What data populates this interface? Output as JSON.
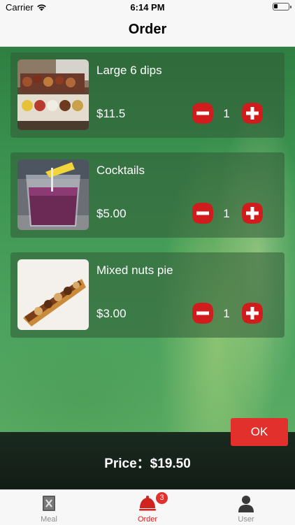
{
  "status_bar": {
    "carrier": "Carrier",
    "time": "6:14 PM"
  },
  "nav": {
    "title": "Order"
  },
  "items": [
    {
      "name": "Large 6 dips",
      "price": "$11.5",
      "quantity": "1"
    },
    {
      "name": "Cocktails",
      "price": "$5.00",
      "quantity": "1"
    },
    {
      "name": "Mixed nuts pie",
      "price": "$3.00",
      "quantity": "1"
    }
  ],
  "summary": {
    "price_label": "Price：$19.50",
    "ok_label": "OK"
  },
  "tabbar": {
    "tabs": [
      {
        "label": "Meal"
      },
      {
        "label": "Order",
        "badge": "3"
      },
      {
        "label": "User"
      }
    ]
  },
  "colors": {
    "accent_red": "#e2302d",
    "active_tab": "#d0231f",
    "background_green": "#3d9552"
  }
}
